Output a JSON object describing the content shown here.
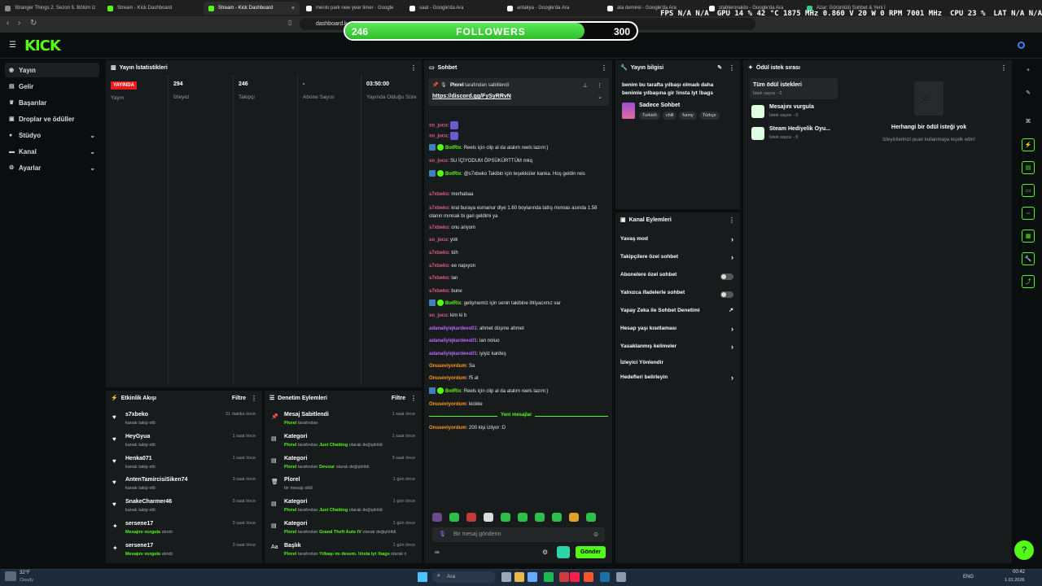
{
  "browser": {
    "tabs": [
      {
        "label": "Stranger Things 2. Sezon 5. Bölüm iz",
        "color": "#8c8c8c"
      },
      {
        "label": "Stream - Kick Dashboard",
        "color": "#53fc18"
      },
      {
        "label": "Stream - Kick Dashboard",
        "color": "#53fc18",
        "active": true
      },
      {
        "label": "menlo park new year timer - Google",
        "color": "#ffffff"
      },
      {
        "label": "saat - Google'da Ara",
        "color": "#ffffff"
      },
      {
        "label": "antakya - Google'da Ara",
        "color": "#ffffff"
      },
      {
        "label": "ata demirel - Google'da Ara",
        "color": "#ffffff"
      },
      {
        "label": "stableronaldo - Google'da Ara",
        "color": "#ffffff"
      },
      {
        "label": "Azar: Görüntülü Sohbet & Yeni İ",
        "color": "#35c98a"
      }
    ],
    "tab_close": "×",
    "url": "dashboard.k",
    "hud": {
      "fps": "FPS N/A N/A",
      "gpu": "GPU 14 % 42 °C 1875 MHz 0.860 V 20 W 0 RPM 7001 MHz",
      "cpu": "CPU 23 %",
      "lat": "LAT N/A N/A"
    }
  },
  "followers_widget": {
    "current": "246",
    "label": "FOLLOWERS",
    "goal": "300",
    "progress": 0.82
  },
  "kick": {
    "logo": "KICK"
  },
  "sidebar": {
    "items": [
      {
        "label": "Yayın",
        "icon": "broadcast-icon"
      },
      {
        "label": "Gelir",
        "icon": "revenue-icon"
      },
      {
        "label": "Başarılar",
        "icon": "trophy-icon"
      },
      {
        "label": "Droplar ve ödüller",
        "icon": "gift-icon"
      },
      {
        "label": "Stüdyo",
        "icon": "studio-icon",
        "chevron": true
      },
      {
        "label": "Kanal",
        "icon": "channel-icon",
        "chevron": true
      },
      {
        "label": "Ayarlar",
        "icon": "gear-icon",
        "chevron": true
      }
    ]
  },
  "stats": {
    "title": "Yayın İstatistikleri",
    "live_badge": "YAYINDA",
    "live_label": "Yayın",
    "cols": [
      {
        "value": "294",
        "label": "İzleyici"
      },
      {
        "value": "246",
        "label": "Takipçi"
      },
      {
        "value": "-",
        "label": "Abone Sayısı"
      },
      {
        "value": "03:50:00",
        "label": "Yayında Olduğu Süre"
      }
    ]
  },
  "activity": {
    "title": "Etkinlik Akışı",
    "filter": "Filtre",
    "items": [
      {
        "name": "s7xbeko",
        "desc": "kanalı takip etti",
        "time": "21 dakika önce",
        "icon": "heart-icon"
      },
      {
        "name": "HeyGyua",
        "desc": "kanalı takip etti",
        "time": "1 saat önce",
        "icon": "heart-icon"
      },
      {
        "name": "Henka071",
        "desc": "kanalı takip etti",
        "time": "1 saat önce",
        "icon": "heart-icon"
      },
      {
        "name": "AntenTamircisiSiken74",
        "desc": "kanalı takip etti",
        "time": "3 saat önce",
        "icon": "heart-icon"
      },
      {
        "name": "SnakeCharmer46",
        "desc": "kanalı takip etti",
        "time": "3 saat önce",
        "icon": "heart-icon"
      },
      {
        "name": "sersene17",
        "desc_hl": "Mesajını vurgula",
        "desc": " alındı",
        "time": "3 saat önce",
        "icon": "reward-icon"
      },
      {
        "name": "sersene17",
        "desc_hl": "Mesajını vurgula",
        "desc": " alındı",
        "time": "3 saat önce",
        "icon": "reward-icon"
      }
    ]
  },
  "moderation": {
    "title": "Denetim Eylemleri",
    "filter": "Filtre",
    "items": [
      {
        "name": "Mesaj Sabitlendi",
        "hl": "Plorel",
        "desc": " tarafından",
        "time": "1 saat önce",
        "icon": "pin-icon"
      },
      {
        "name": "Kategori",
        "hl": "Plorel",
        "desc": " tarafından ",
        "hl2": "Just Chatting",
        "desc2": " olarak değiştirildi",
        "time": "1 saat önce",
        "icon": "category-icon"
      },
      {
        "name": "Kategori",
        "hl": "Plorel",
        "desc": " tarafından ",
        "hl2": "Devour",
        "desc2": " olarak değiştirildi",
        "time": "3 saat önce",
        "icon": "category-icon"
      },
      {
        "name": "Plorel",
        "hl": "",
        "desc": "bir mesajı sildi",
        "time": "1 gün önce",
        "icon": "trash-icon"
      },
      {
        "name": "Kategori",
        "hl": "Plorel",
        "desc": " tarafından ",
        "hl2": "Just Chatting",
        "desc2": " olarak değiştirildi",
        "time": "1 gün önce",
        "icon": "category-icon"
      },
      {
        "name": "Kategori",
        "hl": "Plorel",
        "desc": " tarafından ",
        "hl2": "Grand Theft Auto IV",
        "desc2": " olarak değiştirildi",
        "time": "1 gün önce",
        "icon": "category-icon"
      },
      {
        "name": "Başlık",
        "hl": "Plorel",
        "desc": " tarafından ",
        "hl2": "Yılbaşı mı desem. !insta lyt !bags",
        "desc2": " olarak değiştirildi",
        "time": "1 gün önce",
        "icon": "title-icon"
      }
    ]
  },
  "chat": {
    "title": "Sohbet",
    "pinned_by": "Plorel",
    "pinned_label": " tarafından sabitlendi",
    "pinned_link": "https://discord.gg/FySyRRvN",
    "messages": [
      {
        "user": "so_jucu",
        "color": "#e05d8a",
        "text": "",
        "emote": true
      },
      {
        "user": "so_jucu",
        "color": "#e05d8a",
        "text": "",
        "emote": true
      },
      {
        "user": "BotRix",
        "color": "#53fc18",
        "text": "Reels için clip al da atalım reels lazım:)",
        "bot": true
      },
      {
        "user": "so_jucu",
        "color": "#e05d8a",
        "text": "SU İÇİYODUM ÖPSÜKÜRTTÜM mkq"
      },
      {
        "user": "BotRix",
        "color": "#53fc18",
        "text": "@s7xbeko Takibin için teşekküler kanka. Hoş geldin reis",
        "bot": true
      },
      {
        "user": "s7xbeko",
        "color": "#e05d8a",
        "text": "merhabaa"
      },
      {
        "user": "s7xbeko",
        "color": "#e05d8a",
        "text": "kral buraya esmanur diye 1.60 boylarında tatlış mınnas asında 1.58 olanın mınnak bi gari geldimi ya"
      },
      {
        "user": "s7xbeko",
        "color": "#e05d8a",
        "text": "onu ariyom"
      },
      {
        "user": "so_jucu",
        "color": "#e05d8a",
        "text": "yok"
      },
      {
        "user": "s7xbeko",
        "color": "#e05d8a",
        "text": "tüh"
      },
      {
        "user": "s7xbeko",
        "color": "#e05d8a",
        "text": "ee napıyon"
      },
      {
        "user": "s7xbeko",
        "color": "#e05d8a",
        "text": "lan"
      },
      {
        "user": "s7xbeko",
        "color": "#e05d8a",
        "text": "bune"
      },
      {
        "user": "BotRix",
        "color": "#53fc18",
        "text": "gelişmemiz için senin takibine ihtiyacımız var",
        "bot": true
      },
      {
        "user": "so_jucu",
        "color": "#e05d8a",
        "text": "kim ki b"
      },
      {
        "user": "adanaliyiqkardees01",
        "color": "#b76bff",
        "text": "ahmet düşme ahmet"
      },
      {
        "user": "adanaliyiqkardees01",
        "color": "#b76bff",
        "text": "lan noluo"
      },
      {
        "user": "adanaliyiqkardees01",
        "color": "#b76bff",
        "text": "iyiyiz kardeş"
      },
      {
        "user": "Onuseviyordum",
        "color": "#ff9a1f",
        "text": "Sa"
      },
      {
        "user": "Onuseviyordum",
        "color": "#ff9a1f",
        "text": "f5 at"
      },
      {
        "user": "BotRix",
        "color": "#53fc18",
        "text": "Reels için clip al da atalım reels lazım:)",
        "bot": true
      },
      {
        "user": "Onuseviyordum",
        "color": "#ff9a1f",
        "text": "kickke"
      }
    ],
    "new_messages": "Yeni mesajlar",
    "last": {
      "user": "Onuseviyordum",
      "color": "#ff9a1f",
      "text": "200 kişi izliyor :D"
    },
    "input_placeholder": "Bir mesaj gönderin",
    "send": "Gönder"
  },
  "stream_info": {
    "title_label": "Yayın bilgisi",
    "stream_title": "benim bu tarafta yılbaşı olmadı daha benimle yılbaşına gir !insta lyt !bags",
    "category": "Sadece Sohbet",
    "tags": [
      "Turkish",
      "chill",
      "funny",
      "Türkçe"
    ]
  },
  "channel_actions": {
    "title": "Kanal Eylemleri",
    "items": [
      {
        "label": "Yavaş mod",
        "kind": "arrow"
      },
      {
        "label": "Takipçilere özel sohbet",
        "kind": "arrow"
      },
      {
        "label": "Abonelere özel sohbet",
        "kind": "toggle"
      },
      {
        "label": "Yalnızca ifadelerle sohbet",
        "kind": "toggle"
      },
      {
        "label": "Yapay Zeka ile Sohbet Denetimi",
        "kind": "ext"
      },
      {
        "label": "Hesap yaşı kısıtlaması",
        "kind": "arrow"
      },
      {
        "label": "Yasaklanmış kelimeler",
        "kind": "arrow"
      },
      {
        "label": "İzleyici Yönlendir",
        "kind": "none"
      },
      {
        "label": "Hedefleri belirleyin",
        "kind": "arrow"
      }
    ]
  },
  "rewards": {
    "title": "Ödül istek sırası",
    "all_label": "Tüm ödül istekleri",
    "all_count": "İstek sayısı - 0",
    "items": [
      {
        "label": "Mesajını vurgula",
        "count": "İstek sayısı - 0"
      },
      {
        "label": "Steam Hediyelik Oyu...",
        "count": "İstek sayısı - 0"
      }
    ],
    "empty_title": "Herhangi bir ödül isteği yok",
    "empty_desc": "İzleyicilerinizi puan kullanmaya teşvik edin!"
  },
  "taskbar": {
    "weather_temp": "32°F",
    "weather_desc": "Cloudy",
    "search": "Ara",
    "lang": "ENG",
    "time": "00:42",
    "date": "1.01.2026"
  }
}
